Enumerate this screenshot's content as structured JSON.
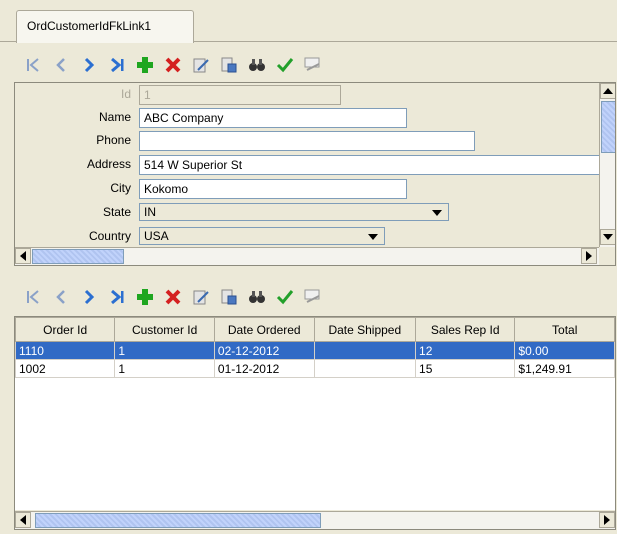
{
  "tab": {
    "label": "OrdCustomerIdFkLink1"
  },
  "toolbar_buttons": [
    "first-record",
    "previous-record",
    "next-record",
    "last-record",
    "add-record",
    "delete-record",
    "edit-record",
    "save-record",
    "find",
    "confirm",
    "filter"
  ],
  "form": {
    "id": {
      "label": "Id",
      "value": "1"
    },
    "name": {
      "label": "Name",
      "value": "ABC Company"
    },
    "phone": {
      "label": "Phone",
      "value": ""
    },
    "address": {
      "label": "Address",
      "value": "514 W Superior St"
    },
    "city": {
      "label": "City",
      "value": "Kokomo"
    },
    "state": {
      "label": "State",
      "value": "IN"
    },
    "country": {
      "label": "Country",
      "value": "USA"
    }
  },
  "grid": {
    "columns": [
      "Order Id",
      "Customer Id",
      "Date Ordered",
      "Date Shipped",
      "Sales Rep Id",
      "Total"
    ],
    "rows": [
      [
        "1110",
        "1",
        "02-12-2012",
        "",
        "12",
        "$0.00"
      ],
      [
        "1002",
        "1",
        "01-12-2012",
        "",
        "15",
        "$1,249.91"
      ]
    ],
    "selected_row": 0
  },
  "colors": {
    "selection": "#316ac5",
    "add_icon": "#1fa61f",
    "delete_icon": "#d42020",
    "nav_icon": "#2b6fd1"
  }
}
